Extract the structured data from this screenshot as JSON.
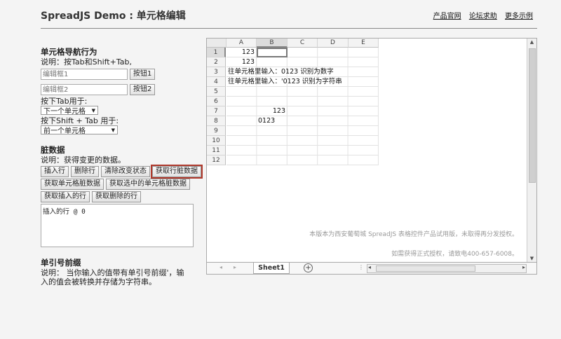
{
  "header": {
    "title": "SpreadJS Demo : 单元格编辑",
    "links": [
      "产品官网",
      "论坛求助",
      "更多示例"
    ]
  },
  "nav_section": {
    "title": "单元格导航行为",
    "desc": "说明：按Tab和Shift+Tab,",
    "input1_placeholder": "编辑框1",
    "button1": "按钮1",
    "input2_placeholder": "编辑框2",
    "button2": "按钮2",
    "tab_label": "按下Tab用于:",
    "tab_select": "下一个单元格",
    "shift_tab_label": "按下Shift + Tab 用于:",
    "shift_tab_select": "前一个单元格"
  },
  "dirty_section": {
    "title": "脏数据",
    "desc": "说明：获得变更的数据。",
    "buttons_row1": [
      "插入行",
      "删除行",
      "清除改变状态",
      "获取行脏数据"
    ],
    "buttons_row2": [
      "获取单元格脏数据",
      "获取选中的单元格脏数据"
    ],
    "buttons_row3": [
      "获取插入的行",
      "获取删除的行"
    ],
    "output": "插入的行 @ 0"
  },
  "quote_section": {
    "title": "单引号前缀",
    "desc": "说明： 当你输入的值带有单引号前缀'，输入的值会被转换并存储为字符串。"
  },
  "sheet": {
    "columns": [
      "A",
      "B",
      "C",
      "D",
      "E"
    ],
    "rows": [
      "1",
      "2",
      "3",
      "4",
      "5",
      "6",
      "7",
      "8",
      "9",
      "10",
      "11",
      "12"
    ],
    "cells": {
      "a1": "123",
      "a2": "123",
      "a3": "往单元格里输入：0123 识别为数字",
      "a4": "往单元格里输入：'0123 识别为字符串",
      "b7": "123",
      "b8": "0123"
    },
    "tab_name": "Sheet1",
    "watermark1": "本版本为西安葡萄城 SpreadJS 表格控件产品试用版，未取得再分发授权。",
    "watermark2": "如需获得正式授权，请致电400-657-6008。"
  }
}
